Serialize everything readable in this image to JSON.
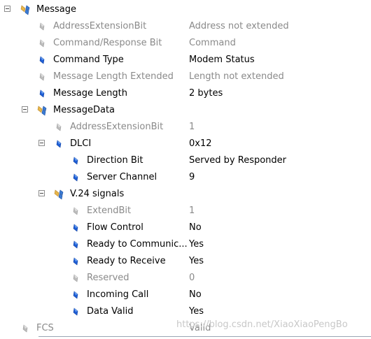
{
  "tree": {
    "message": {
      "label": "Message"
    },
    "address_extension_bit": {
      "label": "AddressExtensionBit",
      "value": "Address not extended"
    },
    "command_response_bit": {
      "label": "Command/Response Bit",
      "value": "Command"
    },
    "command_type": {
      "label": "Command Type",
      "value": "Modem Status"
    },
    "message_length_extended": {
      "label": "Message Length Extended",
      "value": "Length not extended"
    },
    "message_length": {
      "label": "Message Length",
      "value": "2 bytes"
    },
    "message_data": {
      "label": "MessageData"
    },
    "md_address_extension_bit": {
      "label": "AddressExtensionBit",
      "value": "1"
    },
    "dlci": {
      "label": "DLCI",
      "value": "0x12"
    },
    "direction_bit": {
      "label": "Direction Bit",
      "value": "Served by Responder"
    },
    "server_channel": {
      "label": "Server Channel",
      "value": "9"
    },
    "v24_signals": {
      "label": "V.24 signals"
    },
    "extend_bit": {
      "label": "ExtendBit",
      "value": "1"
    },
    "flow_control": {
      "label": "Flow Control",
      "value": "No"
    },
    "ready_to_communicate": {
      "label": "Ready to Communic...",
      "value": "Yes"
    },
    "ready_to_receive": {
      "label": "Ready to Receive",
      "value": "Yes"
    },
    "reserved": {
      "label": "Reserved",
      "value": "0"
    },
    "incoming_call": {
      "label": "Incoming Call",
      "value": "No"
    },
    "data_valid": {
      "label": "Data Valid",
      "value": "Yes"
    },
    "fcs": {
      "label": "FCS",
      "value": "Valid"
    }
  },
  "watermark": "https://blog.csdn.net/XiaoXiaoPengBo",
  "colors": {
    "field_active": "#1f5fd6",
    "field_inactive": "#b9b9b9",
    "struct_gold": "#e8b64a",
    "struct_blue": "#3a7bd5",
    "dim_text": "#8a8a8a"
  }
}
